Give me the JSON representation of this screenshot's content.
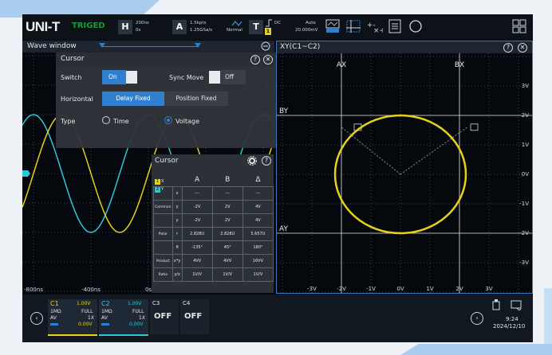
{
  "topbar": {
    "logo": "UNI-T",
    "trigger_status": "TRIGED",
    "horizontal_key": "H",
    "time_base": "200ns",
    "time_offset": "0s",
    "acquire_key": "A",
    "memory_depth": "1.5kpts",
    "sample_rate": "1.25GSa/s",
    "acquire_mode": "Normal",
    "trigger_key": "T",
    "trigger_source_num": "1",
    "trigger_coupling": "DC",
    "trigger_mode": "Auto",
    "trigger_level": "20.000mV"
  },
  "wave_window": {
    "title": "Wave window",
    "x_ticks": [
      "-800ns",
      "-400ns",
      "0s"
    ],
    "right_ticks": [
      "3V",
      "2V",
      "1V",
      "0V"
    ]
  },
  "cursor_dialog": {
    "title": "Cursor",
    "switch_label": "Switch",
    "switch_value": "On",
    "sync_move_label": "Sync Move",
    "sync_move_value": "Off",
    "horizontal_label": "Horizontal",
    "horizontal_options": [
      "Delay Fixed",
      "Position Fixed"
    ],
    "horizontal_selected": "Delay Fixed",
    "type_label": "Type",
    "type_options": [
      "Time",
      "Voltage"
    ],
    "type_selected": "Voltage"
  },
  "measure_panel": {
    "title": "Cursor",
    "col_headers": [
      "A",
      "B",
      "Δ"
    ],
    "rows": [
      {
        "group": "",
        "label": "x",
        "a": "---",
        "b": "---",
        "d": "---"
      },
      {
        "group": "Common",
        "label": "y",
        "a": "-2V",
        "b": "2V",
        "d": "4V"
      },
      {
        "group": "",
        "label": "y",
        "a": "-2V",
        "b": "2V",
        "d": "4V"
      },
      {
        "group": "Polar",
        "label": "r",
        "a": "2.828U",
        "b": "2.828U",
        "d": "5.657U"
      },
      {
        "group": "",
        "label": "θ",
        "a": "-135°",
        "b": "45°",
        "d": "180°"
      },
      {
        "group": "Product",
        "label": "x*y",
        "a": "4VV",
        "b": "4VV",
        "d": "16VV"
      },
      {
        "group": "Ratio",
        "label": "y/x",
        "a": "1V/V",
        "b": "1V/V",
        "d": "1V/V"
      }
    ],
    "ch_tags": [
      "1",
      "2"
    ],
    "ch_labels": [
      "X",
      "Y"
    ]
  },
  "xy_window": {
    "title": "XY(C1~C2)",
    "cursor_labels": [
      "AX",
      "BX",
      "BY",
      "AY"
    ],
    "x_ticks": [
      "-3V",
      "-2V",
      "-1V",
      "0V",
      "1V",
      "2V",
      "3V"
    ],
    "y_ticks": [
      "3V",
      "2V",
      "1V",
      "0V",
      "-1V",
      "-2V",
      "-3V"
    ]
  },
  "channels": [
    {
      "name": "C1",
      "scale": "1.00V",
      "impedance": "1MΩ",
      "bandwidth": "FULL",
      "coupling": "AV",
      "probe": "1X",
      "offset": "0.00V",
      "color": "#e6d21a"
    },
    {
      "name": "C2",
      "scale": "1.00V",
      "impedance": "1MΩ",
      "bandwidth": "FULL",
      "coupling": "AV",
      "probe": "1X",
      "offset": "0.00V",
      "color": "#2fc7d8"
    },
    {
      "name": "C3",
      "state": "OFF"
    },
    {
      "name": "C4",
      "state": "OFF"
    }
  ],
  "status": {
    "time": "9:24",
    "date": "2024/12/10"
  },
  "colors": {
    "ch1": "#e6d21a",
    "ch2": "#2fc7d8",
    "accent": "#2f80d0",
    "trig_green": "#1a9a35"
  }
}
